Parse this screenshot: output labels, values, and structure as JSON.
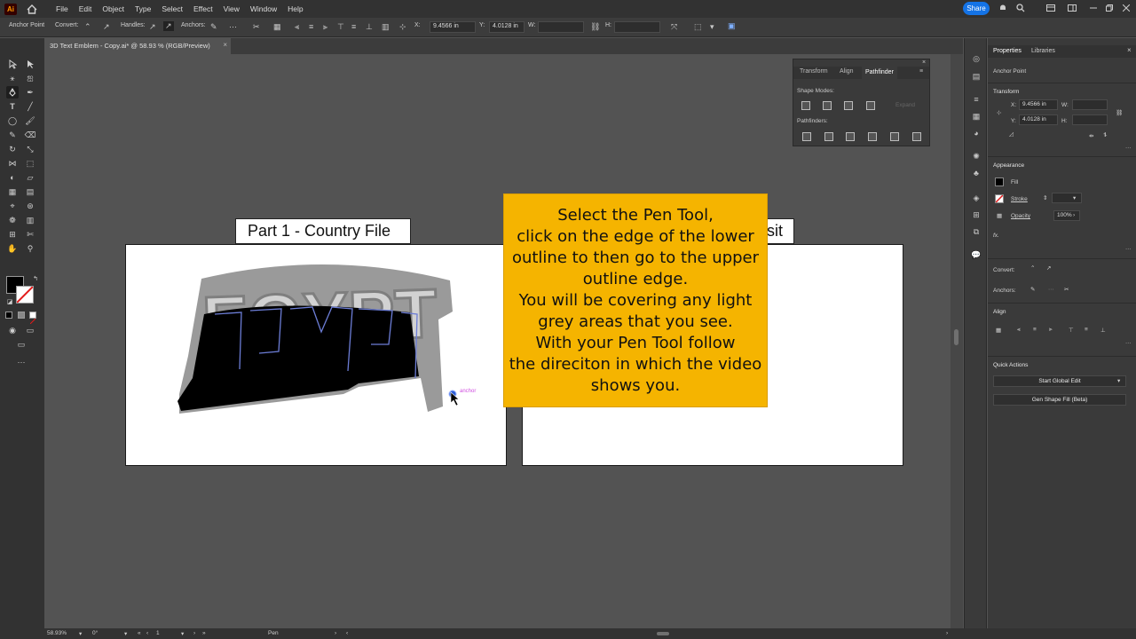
{
  "app": {
    "logo": "Ai"
  },
  "menu": {
    "items": [
      "File",
      "Edit",
      "Object",
      "Type",
      "Select",
      "Effect",
      "View",
      "Window",
      "Help"
    ]
  },
  "share_label": "Share",
  "control_bar": {
    "mode": "Anchor Point",
    "convert": "Convert:",
    "handles": "Handles:",
    "anchors": "Anchors:",
    "x_label": "X:",
    "x_value": "9.4566 in",
    "y_label": "Y:",
    "y_value": "4.0128 in",
    "w_label": "W:",
    "h_label": "H:"
  },
  "document_tab": {
    "title": "3D Text Emblem - Copy.ai* @ 58.93 % (RGB/Preview)",
    "close": "×"
  },
  "artboards": {
    "left_label": "Part 1 - Country File",
    "right_label_partial": "isit",
    "artwork_text": "EGYPT"
  },
  "instruction": {
    "text": "Select the Pen Tool,\nclick on the edge of the lower\noutline to then go to the upper\noutline edge.\nYou will be covering any light\ngrey areas that you see.\nWith your Pen Tool follow\nthe direciton in which the video\nshows you."
  },
  "cursor_hint": "anchor",
  "pathfinder_panel": {
    "tabs": [
      "Transform",
      "Align",
      "Pathfinder"
    ],
    "active_tab": "Pathfinder",
    "shape_modes_label": "Shape Modes:",
    "expand_label": "Expand",
    "pathfinders_label": "Pathfinders:"
  },
  "properties": {
    "tabs": [
      "Properties",
      "Libraries"
    ],
    "selection": "Anchor Point",
    "transform_label": "Transform",
    "x_label": "X:",
    "x_value": "9.4566 in",
    "y_label": "Y:",
    "y_value": "4.0128 in",
    "w_label": "W:",
    "h_label": "H:",
    "appearance_label": "Appearance",
    "fill_label": "Fill",
    "stroke_label": "Stroke",
    "opacity_label": "Opacity",
    "opacity_value": "100%",
    "fx_label": "fx.",
    "convert_label": "Convert:",
    "anchors_label": "Anchors:",
    "align_label": "Align",
    "quick_actions_label": "Quick Actions",
    "global_edit_button": "Start Global Edit",
    "gen_shape_button": "Gen Shape Fill (Beta)",
    "more": "···"
  },
  "status_bar": {
    "zoom": "58.93%",
    "rotation": "0°",
    "artboard_index": "1",
    "tool": "Pen"
  },
  "colors": {
    "accent": "#1473e6",
    "note_bg": "#f5b400",
    "ui_dark": "#323232",
    "canvas": "#535353"
  }
}
